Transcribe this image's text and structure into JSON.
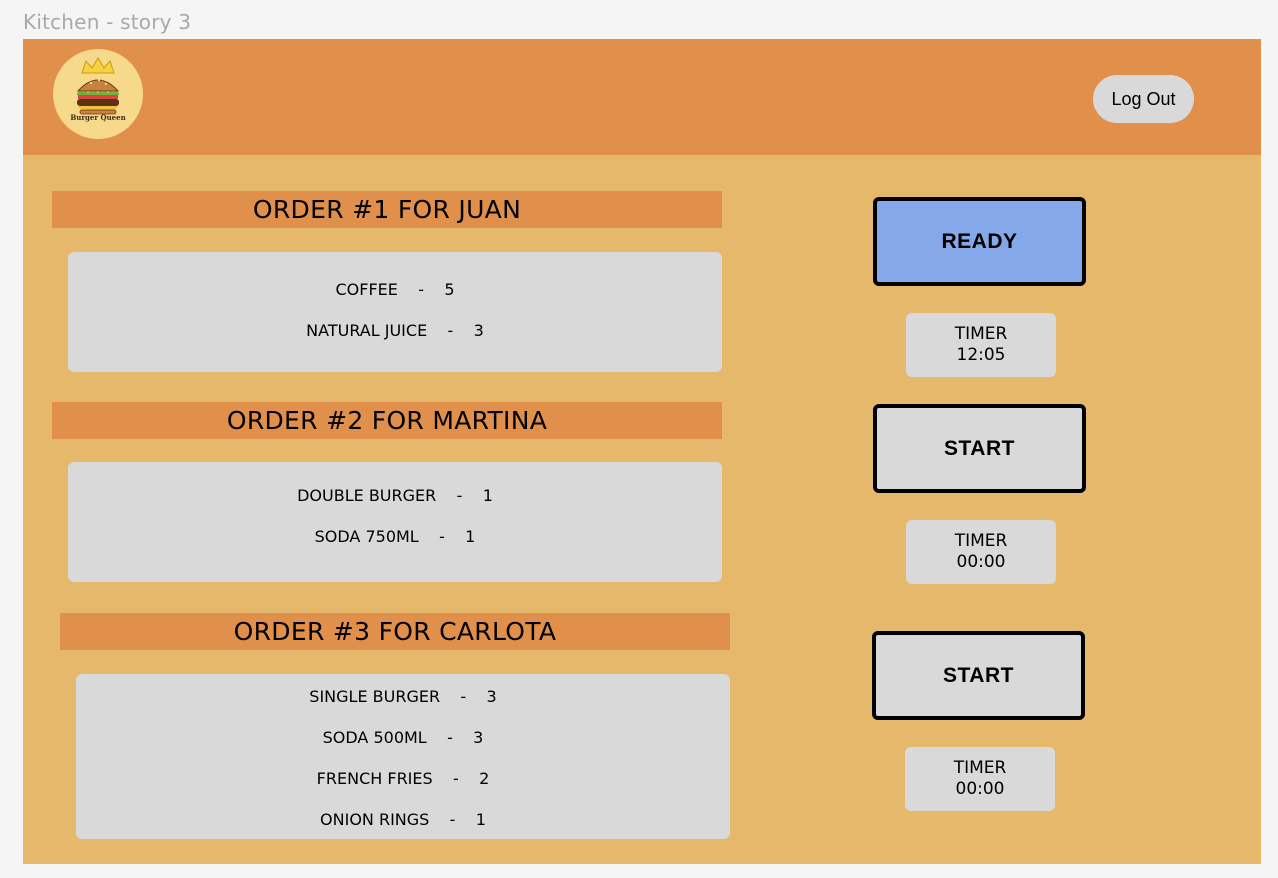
{
  "frame_label": "Kitchen - story 3",
  "header": {
    "logo_text": "Burger Queen",
    "logout_label": "Log Out"
  },
  "orders": [
    {
      "title": "ORDER #1 FOR JUAN",
      "items": [
        "COFFEE    -    5",
        "NATURAL JUICE    -    3"
      ],
      "action": "READY",
      "timer_label": "TIMER",
      "timer_value": "12:05"
    },
    {
      "title": "ORDER #2 FOR MARTINA",
      "items": [
        "DOUBLE BURGER    -    1",
        "SODA 750ML    -    1"
      ],
      "action": "START",
      "timer_label": "TIMER",
      "timer_value": "00:00"
    },
    {
      "title": "ORDER #3 FOR CARLOTA",
      "items": [
        "SINGLE BURGER    -    3",
        "SODA 500ML    -    3",
        "FRENCH FRIES    -    2",
        "ONION RINGS    -    1"
      ],
      "action": "START",
      "timer_label": "TIMER",
      "timer_value": "00:00"
    }
  ],
  "colors": {
    "header": "#e0904a",
    "background": "#e6b86b",
    "ready": "#85a8e8",
    "box": "#d9d9d9"
  }
}
